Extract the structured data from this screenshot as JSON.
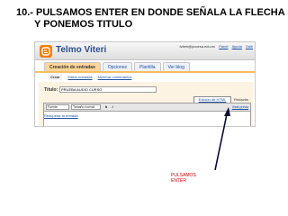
{
  "heading": {
    "line1": "10.- PULSAMOS ENTER EN DONDE SEÑALA LA FLECHA",
    "line2": "Y PONEMOS TITULO"
  },
  "app": {
    "blog_name": "Telmo Viteri",
    "user_email": "tviteri@pucesa.edu.ec",
    "user_links": [
      "Panel",
      "Ayuda",
      "Salir"
    ],
    "logo_icon": "blogger-logo-icon",
    "accent_color": "#f57d00"
  },
  "tabs": [
    "Creación de entradas",
    "Opciones",
    "Plantilla",
    "Ver blog"
  ],
  "subtabs": [
    "Crear",
    "Editar entradas",
    "Moderar comentarios"
  ],
  "editor": {
    "title_label": "Título:",
    "title_value": "PRUEBA AUDIO CURSO",
    "html_tab": "Edición de HTML",
    "compose_tab": "Redactar",
    "font_select": "Fuente",
    "size_select": "Tamaño normal",
    "bold": "b",
    "italic": "i",
    "preview": "Vista previa",
    "recover": "Recuperar la entrada"
  },
  "annotation": {
    "line1": "PULSAMOS",
    "line2": "ENTER",
    "color": "#d10000"
  }
}
